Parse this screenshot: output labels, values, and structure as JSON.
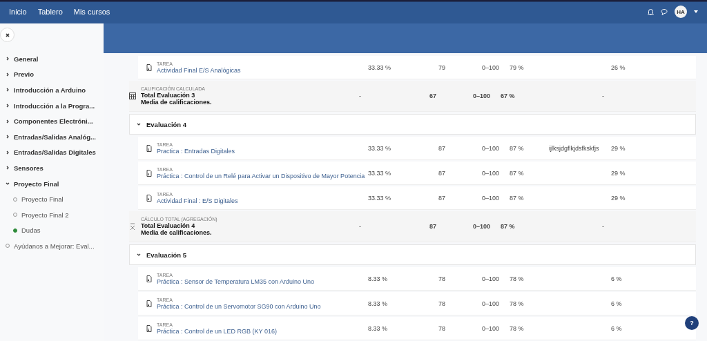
{
  "navbar": {
    "links": [
      "Inicio",
      "Tablero",
      "Mis cursos"
    ],
    "avatar": "HA"
  },
  "sidebar": {
    "items": [
      {
        "kind": "section",
        "label": "General",
        "expanded": false
      },
      {
        "kind": "section",
        "label": "Previo",
        "expanded": false
      },
      {
        "kind": "section",
        "label": "Introducción a Arduino",
        "expanded": false
      },
      {
        "kind": "section",
        "label": "Introducción a la Progra...",
        "expanded": false
      },
      {
        "kind": "section",
        "label": "Componentes Electróni...",
        "expanded": false
      },
      {
        "kind": "section",
        "label": "Entradas/Salidas Analóg...",
        "expanded": false
      },
      {
        "kind": "section",
        "label": "Entradas/Salidas Digitales",
        "expanded": false
      },
      {
        "kind": "section",
        "label": "Sensores",
        "expanded": false
      },
      {
        "kind": "section",
        "label": "Proyecto Final",
        "expanded": true,
        "children": [
          {
            "kind": "activity",
            "label": "Proyecto Final",
            "completed": false
          },
          {
            "kind": "activity",
            "label": "Proyecto Final 2",
            "completed": false
          },
          {
            "kind": "activity",
            "label": "Dudas",
            "completed": true
          }
        ]
      },
      {
        "kind": "activity",
        "label": "Ayúdanos a Mejorar: Eval...",
        "completed": false
      }
    ]
  },
  "grades": {
    "rows": [
      {
        "kind": "item",
        "type": "TAREA",
        "name": "Actividad Final E/S Analógicas",
        "weight": "33.33 %",
        "grade": "79",
        "range": "0–100",
        "percentage": "79 %",
        "contribution": "26 %"
      },
      {
        "kind": "total",
        "type": "CALIFICACIÓN CALCULADA",
        "name": "Total Evaluación 3",
        "note": "Media de calificaciones.",
        "weight": "-",
        "grade": "67",
        "range": "0–100",
        "percentage": "67 %",
        "contribution": "-"
      },
      {
        "kind": "section",
        "name": "Evaluación 4",
        "expanded": true
      },
      {
        "kind": "item",
        "type": "TAREA",
        "name": "Practica : Entradas Digitales",
        "weight": "33.33 %",
        "grade": "87",
        "range": "0–100",
        "percentage": "87 %",
        "feedback": "ijlksjdgflkjdsfkskfjs",
        "contribution": "29 %"
      },
      {
        "kind": "item",
        "type": "TAREA",
        "name": "Práctica : Control de un Relé para Activar un Dispositivo de Mayor Potencia",
        "weight": "33.33 %",
        "grade": "87",
        "range": "0–100",
        "percentage": "87 %",
        "contribution": "29 %"
      },
      {
        "kind": "item",
        "type": "TAREA",
        "name": "Actividad Final : E/S Digitales",
        "weight": "33.33 %",
        "grade": "87",
        "range": "0–100",
        "percentage": "87 %",
        "contribution": "29 %"
      },
      {
        "kind": "total",
        "type": "CÁLCULO TOTAL (AGREGACIÓN)",
        "name": "Total Evaluación 4",
        "note": "Media de calificaciones.",
        "weight": "-",
        "grade": "87",
        "range": "0–100",
        "percentage": "87 %",
        "contribution": "-"
      },
      {
        "kind": "section",
        "name": "Evaluación 5",
        "expanded": true
      },
      {
        "kind": "item",
        "type": "TAREA",
        "name": "Práctica : Sensor de Temperatura LM35 con Arduino Uno",
        "weight": "8.33 %",
        "grade": "78",
        "range": "0–100",
        "percentage": "78 %",
        "contribution": "6 %"
      },
      {
        "kind": "item",
        "type": "TAREA",
        "name": "Práctica : Control de un Servomotor SG90 con Arduino Uno",
        "weight": "8.33 %",
        "grade": "78",
        "range": "0–100",
        "percentage": "78 %",
        "contribution": "6 %"
      },
      {
        "kind": "item",
        "type": "TAREA",
        "name": "Práctica : Control de un LED RGB (KY 016)",
        "weight": "8.33 %",
        "grade": "78",
        "range": "0–100",
        "percentage": "78 %",
        "contribution": "6 %"
      }
    ]
  },
  "help_button": "?"
}
